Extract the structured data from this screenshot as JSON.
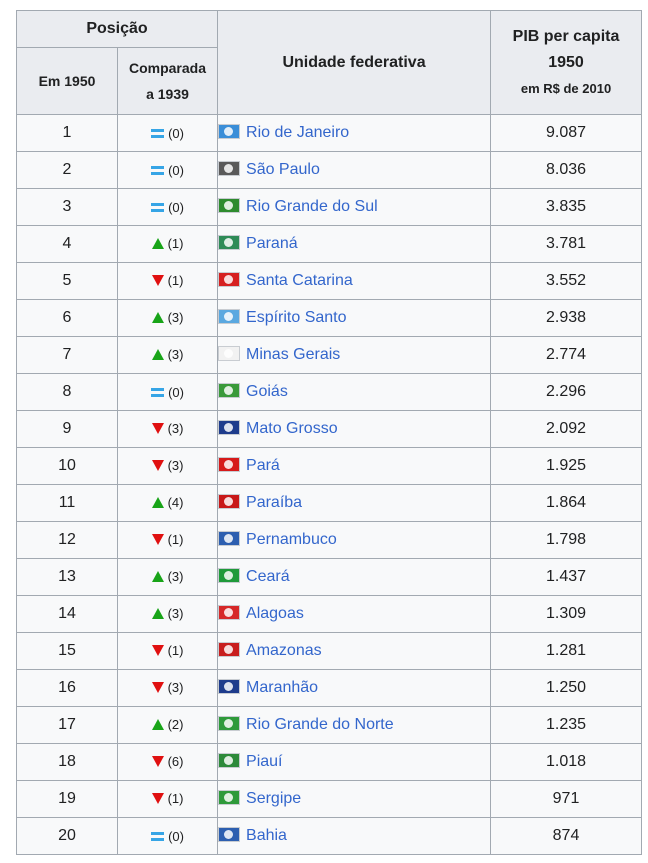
{
  "header": {
    "position": "Posição",
    "in_1950": "Em 1950",
    "compared_line1": "Comparada",
    "compared_line2": "a 1939",
    "unit": "Unidade federativa",
    "pib_line1": "PIB per capita",
    "pib_line2": "1950",
    "pib_line3": "em R$ de 2010"
  },
  "colors": {
    "up": "#18a418",
    "down": "#e01010",
    "same": "#36a5e6",
    "link": "#3366cc"
  },
  "rows": [
    {
      "rank": "1",
      "trend": "same",
      "change": "(0)",
      "state": "Rio de Janeiro",
      "flag_color": "#3a8ed8",
      "pib": "9.087"
    },
    {
      "rank": "2",
      "trend": "same",
      "change": "(0)",
      "state": "São Paulo",
      "flag_color": "#5a5a5a",
      "pib": "8.036"
    },
    {
      "rank": "3",
      "trend": "same",
      "change": "(0)",
      "state": "Rio Grande do Sul",
      "flag_color": "#2e8b2e",
      "pib": "3.835"
    },
    {
      "rank": "4",
      "trend": "up",
      "change": "(1)",
      "state": "Paraná",
      "flag_color": "#2e8b57",
      "pib": "3.781"
    },
    {
      "rank": "5",
      "trend": "down",
      "change": "(1)",
      "state": "Santa Catarina",
      "flag_color": "#d62020",
      "pib": "3.552"
    },
    {
      "rank": "6",
      "trend": "up",
      "change": "(3)",
      "state": "Espírito Santo",
      "flag_color": "#5aa8e0",
      "pib": "2.938"
    },
    {
      "rank": "7",
      "trend": "up",
      "change": "(3)",
      "state": "Minas Gerais",
      "flag_color": "#f2f2f2",
      "pib": "2.774"
    },
    {
      "rank": "8",
      "trend": "same",
      "change": "(0)",
      "state": "Goiás",
      "flag_color": "#3a9a3a",
      "pib": "2.296"
    },
    {
      "rank": "9",
      "trend": "down",
      "change": "(3)",
      "state": "Mato Grosso",
      "flag_color": "#1e3c8c",
      "pib": "2.092"
    },
    {
      "rank": "10",
      "trend": "down",
      "change": "(3)",
      "state": "Pará",
      "flag_color": "#d61a1a",
      "pib": "1.925"
    },
    {
      "rank": "11",
      "trend": "up",
      "change": "(4)",
      "state": "Paraíba",
      "flag_color": "#c81818",
      "pib": "1.864"
    },
    {
      "rank": "12",
      "trend": "down",
      "change": "(1)",
      "state": "Pernambuco",
      "flag_color": "#2d5fb0",
      "pib": "1.798"
    },
    {
      "rank": "13",
      "trend": "up",
      "change": "(3)",
      "state": "Ceará",
      "flag_color": "#1f9a3a",
      "pib": "1.437"
    },
    {
      "rank": "14",
      "trend": "up",
      "change": "(3)",
      "state": "Alagoas",
      "flag_color": "#d62828",
      "pib": "1.309"
    },
    {
      "rank": "15",
      "trend": "down",
      "change": "(1)",
      "state": "Amazonas",
      "flag_color": "#c81e1e",
      "pib": "1.281"
    },
    {
      "rank": "16",
      "trend": "down",
      "change": "(3)",
      "state": "Maranhão",
      "flag_color": "#1e3c8c",
      "pib": "1.250"
    },
    {
      "rank": "17",
      "trend": "up",
      "change": "(2)",
      "state": "Rio Grande do Norte",
      "flag_color": "#2e9a3a",
      "pib": "1.235"
    },
    {
      "rank": "18",
      "trend": "down",
      "change": "(6)",
      "state": "Piauí",
      "flag_color": "#2d8a3a",
      "pib": "1.018"
    },
    {
      "rank": "19",
      "trend": "down",
      "change": "(1)",
      "state": "Sergipe",
      "flag_color": "#2e9a3a",
      "pib": "971"
    },
    {
      "rank": "20",
      "trend": "same",
      "change": "(0)",
      "state": "Bahia",
      "flag_color": "#2d5fb0",
      "pib": "874"
    }
  ]
}
